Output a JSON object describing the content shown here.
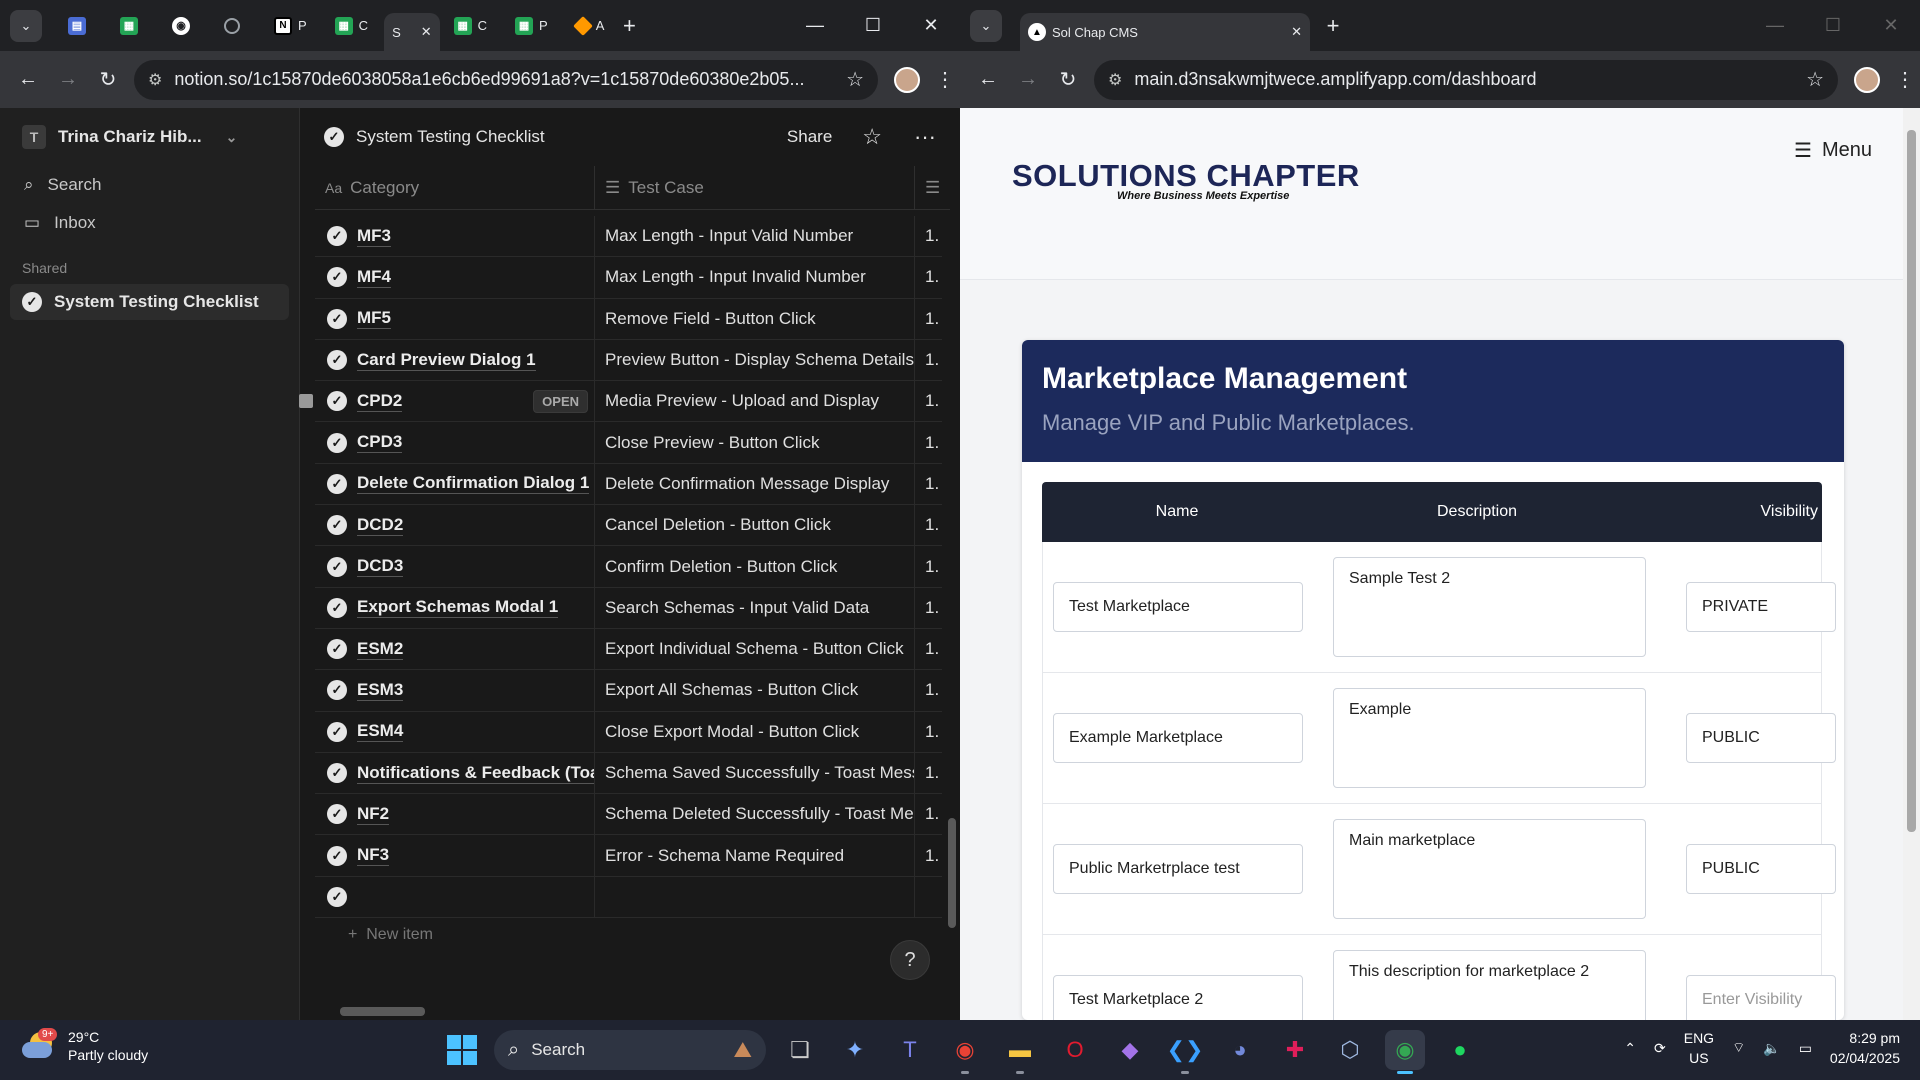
{
  "left_browser": {
    "tabs": [
      {
        "icon": "forms-icon",
        "label": ""
      },
      {
        "icon": "sheets-icon",
        "label": ""
      },
      {
        "icon": "github-icon",
        "label": ""
      },
      {
        "icon": "globe-icon",
        "label": ""
      },
      {
        "icon": "notion-icon",
        "label": "P"
      },
      {
        "icon": "sheets-icon",
        "label": "C"
      },
      {
        "icon": "notion-icon",
        "label": "S",
        "active": true
      },
      {
        "icon": "sheets-icon",
        "label": "C"
      },
      {
        "icon": "sheets-icon",
        "label": "P"
      },
      {
        "icon": "aws-icon",
        "label": "A"
      }
    ],
    "url": "notion.so/1c15870de6038058a1e6cb6ed99691a8?v=1c15870de60380e2b05..."
  },
  "notion": {
    "workspace": "Trina Chariz Hib...",
    "workspace_initial": "T",
    "search": "Search",
    "inbox": "Inbox",
    "shared_header": "Shared",
    "shared_page": "System Testing Checklist",
    "page_title": "System Testing Checklist",
    "share": "Share",
    "col_category": "Category",
    "col_testcase": "Test Case",
    "open_label": "OPEN",
    "new_item": "New item",
    "help": "?",
    "rows": [
      {
        "category": "MF3",
        "test_case": "Max Length - Input Valid Number",
        "c3": "1."
      },
      {
        "category": "MF4",
        "test_case": "Max Length - Input Invalid Number",
        "c3": "1."
      },
      {
        "category": "MF5",
        "test_case": "Remove Field - Button Click",
        "c3": "1."
      },
      {
        "category": "Card Preview Dialog 1",
        "test_case": "Preview Button - Display Schema Details",
        "c3": "1."
      },
      {
        "category": "CPD2",
        "test_case": "Media Preview - Upload and Display",
        "c3": "1.",
        "hover": true
      },
      {
        "category": "CPD3",
        "test_case": "Close Preview - Button Click",
        "c3": "1."
      },
      {
        "category": "Delete Confirmation Dialog 1",
        "test_case": "Delete Confirmation Message Display",
        "c3": "1."
      },
      {
        "category": "DCD2",
        "test_case": "Cancel Deletion - Button Click",
        "c3": "1."
      },
      {
        "category": "DCD3",
        "test_case": "Confirm Deletion - Button Click",
        "c3": "1."
      },
      {
        "category": "Export Schemas Modal 1",
        "test_case": "Search Schemas - Input Valid Data",
        "c3": "1."
      },
      {
        "category": "ESM2",
        "test_case": "Export Individual Schema - Button Click",
        "c3": "1."
      },
      {
        "category": "ESM3",
        "test_case": "Export All Schemas - Button Click",
        "c3": "1."
      },
      {
        "category": "ESM4",
        "test_case": "Close Export Modal - Button Click",
        "c3": "1."
      },
      {
        "category": "Notifications & Feedback (Toas",
        "test_case": "Schema Saved Successfully - Toast Mess",
        "c3": "1."
      },
      {
        "category": "NF2",
        "test_case": "Schema Deleted Successfully - Toast Me",
        "c3": "1."
      },
      {
        "category": "NF3",
        "test_case": "Error - Schema Name Required",
        "c3": "1."
      },
      {
        "category": "",
        "test_case": "",
        "c3": ""
      }
    ]
  },
  "right_browser": {
    "tab_title": "Sol Chap CMS",
    "url": "main.d3nsakwmjtwece.amplifyapp.com/dashboard"
  },
  "site": {
    "logo_main": "SOLUTIONS CHAPTER",
    "logo_tag": "Where Business Meets Expertise",
    "menu": "Menu",
    "card_title": "Marketplace Management",
    "card_subtitle": "Manage VIP and Public Marketplaces.",
    "col_name": "Name",
    "col_description": "Description",
    "col_visibility": "Visibility",
    "rows": [
      {
        "name": "Test Marketplace",
        "description": "Sample Test 2",
        "visibility": "PRIVATE"
      },
      {
        "name": "Example Marketplace",
        "description": "Example",
        "visibility": "PUBLIC"
      },
      {
        "name": "Public Marketrplace test",
        "description": "Main marketplace",
        "visibility": "PUBLIC"
      },
      {
        "name": "Test Marketplace 2",
        "description": "This description for marketplace 2",
        "visibility": "",
        "visibility_placeholder": "Enter Visibility"
      }
    ]
  },
  "taskbar": {
    "temp": "29°C",
    "weather": "Partly cloudy",
    "weather_badge": "9+",
    "search": "Search",
    "lang1": "ENG",
    "lang2": "US",
    "time": "8:29 pm",
    "date": "02/04/2025"
  }
}
